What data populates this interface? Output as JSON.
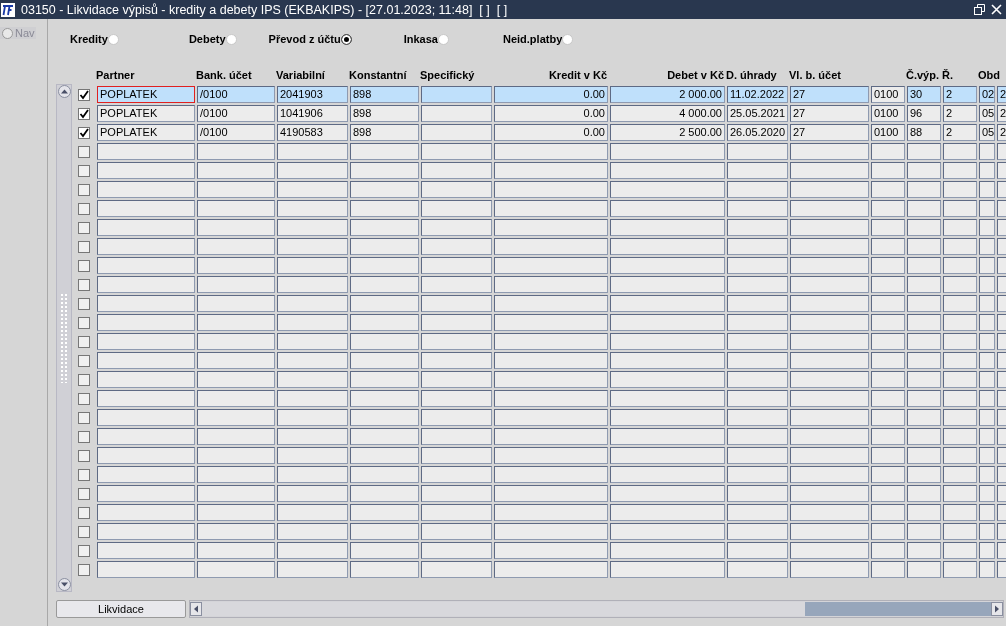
{
  "window": {
    "title": "03150 - Likvidace výpisů - kredity a debety IPS (EKBAKIPS) - [27.01.2023; 11:48]  [ ]  [ ]"
  },
  "sidebar": {
    "nav": {
      "label": "Nav",
      "selected": false
    }
  },
  "filters": [
    {
      "label": "Kredity",
      "selected": false
    },
    {
      "label": "Debety",
      "selected": false
    },
    {
      "label": "Převod z účtu",
      "selected": true
    },
    {
      "label": "Inkasa",
      "selected": false
    },
    {
      "label": "Neid.platby",
      "selected": false
    }
  ],
  "table": {
    "columns": [
      "Partner",
      "Bank. účet",
      "Variabilní",
      "Konstantní",
      "Specifický",
      "Kredit v Kč",
      "Debet v Kč",
      "D. úhrady",
      "Vl. b. účet",
      "",
      "Č.výp.",
      "Ř.",
      "Obd",
      ""
    ],
    "rows": [
      {
        "checked": true,
        "selected": true,
        "focused": true,
        "cells": [
          "POPLATEK",
          "/0100",
          "2041903",
          "898",
          "",
          "0.00",
          "2 000.00",
          "11.02.2022",
          "27",
          "0100",
          "30",
          "2",
          "02",
          "2"
        ]
      },
      {
        "checked": true,
        "selected": false,
        "focused": false,
        "cells": [
          "POPLATEK",
          "/0100",
          "1041906",
          "898",
          "",
          "0.00",
          "4 000.00",
          "25.05.2021",
          "27",
          "0100",
          "96",
          "2",
          "05",
          "2"
        ]
      },
      {
        "checked": true,
        "selected": false,
        "focused": false,
        "cells": [
          "POPLATEK",
          "/0100",
          "4190583",
          "898",
          "",
          "0.00",
          "2 500.00",
          "26.05.2020",
          "27",
          "0100",
          "88",
          "2",
          "05",
          "2"
        ]
      },
      {
        "checked": false,
        "selected": false,
        "focused": false
      },
      {
        "checked": false,
        "selected": false,
        "focused": false
      },
      {
        "checked": false,
        "selected": false,
        "focused": false
      },
      {
        "checked": false,
        "selected": false,
        "focused": false
      },
      {
        "checked": false,
        "selected": false,
        "focused": false
      },
      {
        "checked": false,
        "selected": false,
        "focused": false
      },
      {
        "checked": false,
        "selected": false,
        "focused": false
      },
      {
        "checked": false,
        "selected": false,
        "focused": false
      },
      {
        "checked": false,
        "selected": false,
        "focused": false
      },
      {
        "checked": false,
        "selected": false,
        "focused": false
      },
      {
        "checked": false,
        "selected": false,
        "focused": false
      },
      {
        "checked": false,
        "selected": false,
        "focused": false
      },
      {
        "checked": false,
        "selected": false,
        "focused": false
      },
      {
        "checked": false,
        "selected": false,
        "focused": false
      },
      {
        "checked": false,
        "selected": false,
        "focused": false
      },
      {
        "checked": false,
        "selected": false,
        "focused": false
      },
      {
        "checked": false,
        "selected": false,
        "focused": false
      },
      {
        "checked": false,
        "selected": false,
        "focused": false
      },
      {
        "checked": false,
        "selected": false,
        "focused": false
      },
      {
        "checked": false,
        "selected": false,
        "focused": false
      },
      {
        "checked": false,
        "selected": false,
        "focused": false
      },
      {
        "checked": false,
        "selected": false,
        "focused": false
      },
      {
        "checked": false,
        "selected": false,
        "focused": false
      }
    ]
  },
  "buttons": [
    {
      "label": "Likvidace"
    }
  ]
}
